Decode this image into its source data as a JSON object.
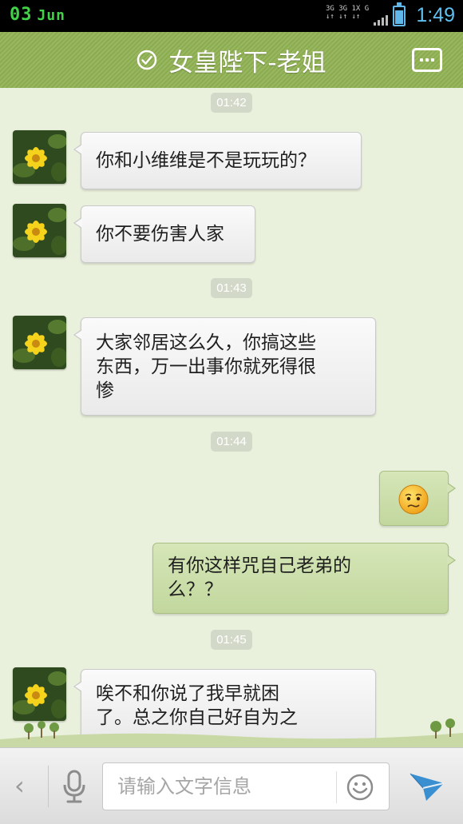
{
  "status_bar": {
    "date_day": "03",
    "date_month": "Jun",
    "net_line1": "3G 3G 1X  G",
    "net_line2": "↓↑ ↓↑ ↓↑",
    "time": "1:49",
    "battery_color": "#5fb7ea"
  },
  "header": {
    "title": "女皇陛下-老姐",
    "verified_icon": "check-circle-icon",
    "menu_icon": "more-dots-icon",
    "background_color": "#8fb152"
  },
  "messages": [
    {
      "type": "timestamp",
      "text": "01:42"
    },
    {
      "type": "incoming",
      "lines": [
        "你和小维维是不是玩玩的？"
      ]
    },
    {
      "type": "incoming",
      "lines": [
        "你不要伤害人家"
      ]
    },
    {
      "type": "timestamp",
      "text": "01:43"
    },
    {
      "type": "incoming",
      "lines": [
        "大家邻居这么久，你搞这些",
        "东西，万一出事你就死得很",
        "惨"
      ]
    },
    {
      "type": "timestamp",
      "text": "01:44"
    },
    {
      "type": "outgoing",
      "emoji": "worried-face-emoji"
    },
    {
      "type": "outgoing",
      "lines": [
        "有你这样咒自己老弟的",
        "么？？"
      ]
    },
    {
      "type": "timestamp",
      "text": "01:45"
    },
    {
      "type": "incoming",
      "lines": [
        "唉不和你说了我早就困",
        "了。总之你自己好自为之"
      ]
    }
  ],
  "input_bar": {
    "back_icon": "chevron-left-icon",
    "back_glyph": "‹",
    "voice_icon": "microphone-icon",
    "placeholder": "请输入文字信息",
    "emoji_icon": "smiley-icon",
    "send_icon": "send-paper-plane-icon",
    "send_color": "#3a8fd1"
  }
}
